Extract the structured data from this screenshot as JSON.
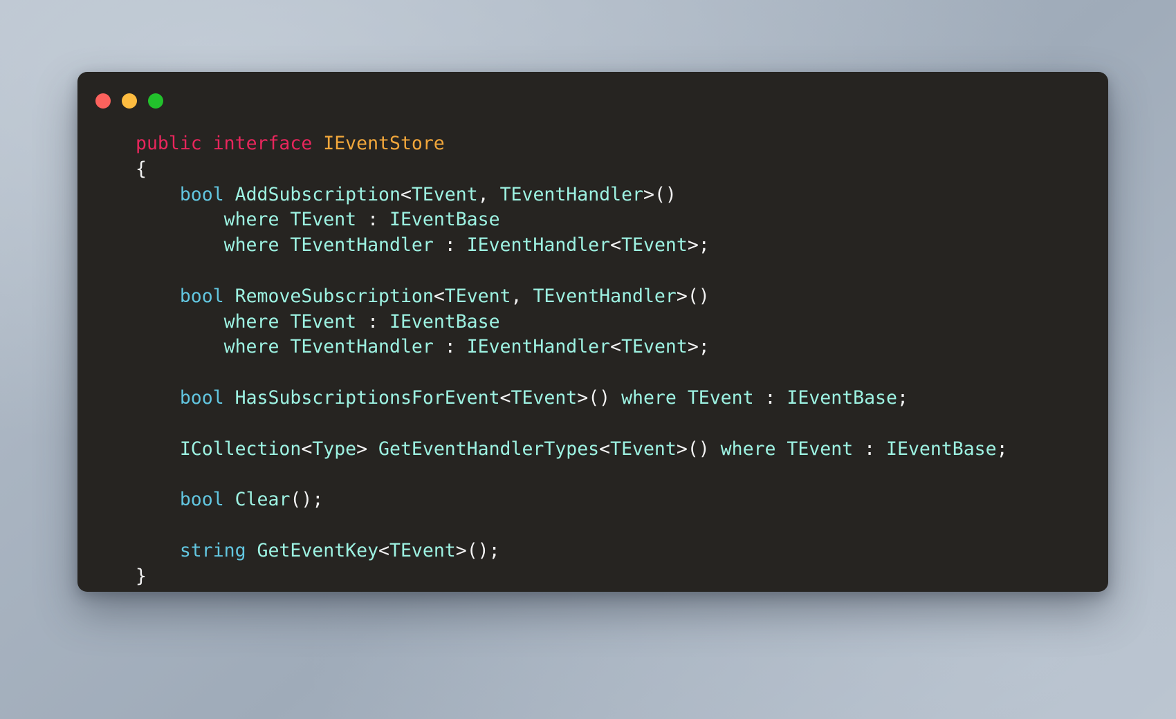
{
  "window": {
    "traffic_lights": [
      {
        "name": "close",
        "color": "#fc625d"
      },
      {
        "name": "minimize",
        "color": "#fdbc40"
      },
      {
        "name": "maximize",
        "color": "#22c12c"
      }
    ],
    "background_color": "#262421"
  },
  "theme": {
    "backdrop_gradient_from": "#b6c0cb",
    "backdrop_gradient_to": "#b9c3ce",
    "keyword_color": "#e8265c",
    "type_color": "#f2a73b",
    "primitive_color": "#62c6e0",
    "identifier_color": "#9df2e2",
    "punctuation_color": "#f2f2f2"
  },
  "code": {
    "language": "C#",
    "plain_text": "public interface IEventStore\n{\n    bool AddSubscription<TEvent, TEventHandler>()\n        where TEvent : IEventBase\n        where TEventHandler : IEventHandler<TEvent>;\n\n    bool RemoveSubscription<TEvent, TEventHandler>()\n        where TEvent : IEventBase\n        where TEventHandler : IEventHandler<TEvent>;\n\n    bool HasSubscriptionsForEvent<TEvent>() where TEvent : IEventBase;\n\n    ICollection<Type> GetEventHandlerTypes<TEvent>() where TEvent : IEventBase;\n\n    bool Clear();\n\n    string GetEventKey<TEvent>();\n}",
    "lines": [
      {
        "id": "l1",
        "tokens": [
          {
            "t": "public",
            "c": "kw"
          },
          {
            "t": " ",
            "c": "punct"
          },
          {
            "t": "interface",
            "c": "kw"
          },
          {
            "t": " ",
            "c": "punct"
          },
          {
            "t": "IEventStore",
            "c": "type"
          }
        ]
      },
      {
        "id": "l2",
        "tokens": [
          {
            "t": "{",
            "c": "punct"
          }
        ]
      },
      {
        "id": "l3",
        "tokens": [
          {
            "t": "    ",
            "c": "punct"
          },
          {
            "t": "bool",
            "c": "prim"
          },
          {
            "t": " ",
            "c": "punct"
          },
          {
            "t": "AddSubscription",
            "c": "ident"
          },
          {
            "t": "<",
            "c": "punct"
          },
          {
            "t": "TEvent",
            "c": "ident"
          },
          {
            "t": ", ",
            "c": "punct"
          },
          {
            "t": "TEventHandler",
            "c": "ident"
          },
          {
            "t": ">()",
            "c": "punct"
          }
        ]
      },
      {
        "id": "l4",
        "tokens": [
          {
            "t": "        ",
            "c": "punct"
          },
          {
            "t": "where",
            "c": "ident"
          },
          {
            "t": " ",
            "c": "punct"
          },
          {
            "t": "TEvent",
            "c": "ident"
          },
          {
            "t": " : ",
            "c": "punct"
          },
          {
            "t": "IEventBase",
            "c": "ident"
          }
        ]
      },
      {
        "id": "l5",
        "tokens": [
          {
            "t": "        ",
            "c": "punct"
          },
          {
            "t": "where",
            "c": "ident"
          },
          {
            "t": " ",
            "c": "punct"
          },
          {
            "t": "TEventHandler",
            "c": "ident"
          },
          {
            "t": " : ",
            "c": "punct"
          },
          {
            "t": "IEventHandler",
            "c": "ident"
          },
          {
            "t": "<",
            "c": "punct"
          },
          {
            "t": "TEvent",
            "c": "ident"
          },
          {
            "t": ">;",
            "c": "punct"
          }
        ]
      },
      {
        "id": "l6",
        "tokens": []
      },
      {
        "id": "l7",
        "tokens": [
          {
            "t": "    ",
            "c": "punct"
          },
          {
            "t": "bool",
            "c": "prim"
          },
          {
            "t": " ",
            "c": "punct"
          },
          {
            "t": "RemoveSubscription",
            "c": "ident"
          },
          {
            "t": "<",
            "c": "punct"
          },
          {
            "t": "TEvent",
            "c": "ident"
          },
          {
            "t": ", ",
            "c": "punct"
          },
          {
            "t": "TEventHandler",
            "c": "ident"
          },
          {
            "t": ">()",
            "c": "punct"
          }
        ]
      },
      {
        "id": "l8",
        "tokens": [
          {
            "t": "        ",
            "c": "punct"
          },
          {
            "t": "where",
            "c": "ident"
          },
          {
            "t": " ",
            "c": "punct"
          },
          {
            "t": "TEvent",
            "c": "ident"
          },
          {
            "t": " : ",
            "c": "punct"
          },
          {
            "t": "IEventBase",
            "c": "ident"
          }
        ]
      },
      {
        "id": "l9",
        "tokens": [
          {
            "t": "        ",
            "c": "punct"
          },
          {
            "t": "where",
            "c": "ident"
          },
          {
            "t": " ",
            "c": "punct"
          },
          {
            "t": "TEventHandler",
            "c": "ident"
          },
          {
            "t": " : ",
            "c": "punct"
          },
          {
            "t": "IEventHandler",
            "c": "ident"
          },
          {
            "t": "<",
            "c": "punct"
          },
          {
            "t": "TEvent",
            "c": "ident"
          },
          {
            "t": ">;",
            "c": "punct"
          }
        ]
      },
      {
        "id": "l10",
        "tokens": []
      },
      {
        "id": "l11",
        "tokens": [
          {
            "t": "    ",
            "c": "punct"
          },
          {
            "t": "bool",
            "c": "prim"
          },
          {
            "t": " ",
            "c": "punct"
          },
          {
            "t": "HasSubscriptionsForEvent",
            "c": "ident"
          },
          {
            "t": "<",
            "c": "punct"
          },
          {
            "t": "TEvent",
            "c": "ident"
          },
          {
            "t": ">() ",
            "c": "punct"
          },
          {
            "t": "where",
            "c": "ident"
          },
          {
            "t": " ",
            "c": "punct"
          },
          {
            "t": "TEvent",
            "c": "ident"
          },
          {
            "t": " : ",
            "c": "punct"
          },
          {
            "t": "IEventBase",
            "c": "ident"
          },
          {
            "t": ";",
            "c": "punct"
          }
        ]
      },
      {
        "id": "l12",
        "tokens": []
      },
      {
        "id": "l13",
        "tokens": [
          {
            "t": "    ",
            "c": "punct"
          },
          {
            "t": "ICollection",
            "c": "ident"
          },
          {
            "t": "<",
            "c": "punct"
          },
          {
            "t": "Type",
            "c": "ident"
          },
          {
            "t": "> ",
            "c": "punct"
          },
          {
            "t": "GetEventHandlerTypes",
            "c": "ident"
          },
          {
            "t": "<",
            "c": "punct"
          },
          {
            "t": "TEvent",
            "c": "ident"
          },
          {
            "t": ">() ",
            "c": "punct"
          },
          {
            "t": "where",
            "c": "ident"
          },
          {
            "t": " ",
            "c": "punct"
          },
          {
            "t": "TEvent",
            "c": "ident"
          },
          {
            "t": " : ",
            "c": "punct"
          },
          {
            "t": "IEventBase",
            "c": "ident"
          },
          {
            "t": ";",
            "c": "punct"
          }
        ]
      },
      {
        "id": "l14",
        "tokens": []
      },
      {
        "id": "l15",
        "tokens": [
          {
            "t": "    ",
            "c": "punct"
          },
          {
            "t": "bool",
            "c": "prim"
          },
          {
            "t": " ",
            "c": "punct"
          },
          {
            "t": "Clear",
            "c": "ident"
          },
          {
            "t": "();",
            "c": "punct"
          }
        ]
      },
      {
        "id": "l16",
        "tokens": []
      },
      {
        "id": "l17",
        "tokens": [
          {
            "t": "    ",
            "c": "punct"
          },
          {
            "t": "string",
            "c": "prim"
          },
          {
            "t": " ",
            "c": "punct"
          },
          {
            "t": "GetEventKey",
            "c": "ident"
          },
          {
            "t": "<",
            "c": "punct"
          },
          {
            "t": "TEvent",
            "c": "ident"
          },
          {
            "t": ">();",
            "c": "punct"
          }
        ]
      },
      {
        "id": "l18",
        "tokens": [
          {
            "t": "}",
            "c": "punct"
          }
        ]
      }
    ]
  }
}
